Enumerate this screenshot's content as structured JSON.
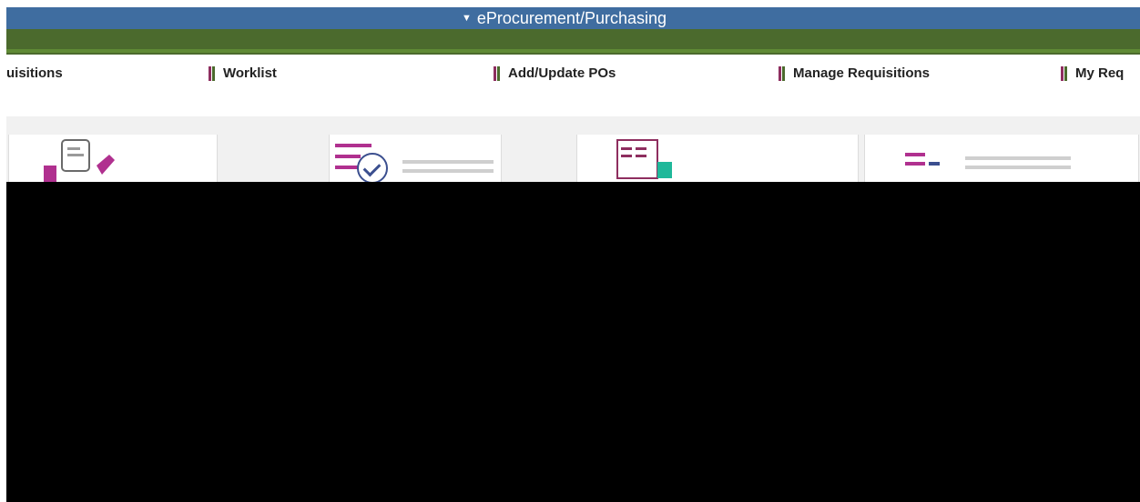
{
  "banner": {
    "title": "eProcurement/Purchasing"
  },
  "tabs": [
    {
      "label": "uisitions"
    },
    {
      "label": "Worklist"
    },
    {
      "label": "Add/Update POs"
    },
    {
      "label": "Manage Requisitions"
    },
    {
      "label": "My Req"
    }
  ],
  "colors": {
    "banner": "#3f6da0",
    "navbar": "#4b6a2d",
    "accent_magenta": "#b0308f",
    "accent_teal": "#1fb89a",
    "accent_navy": "#3b4f8f"
  }
}
